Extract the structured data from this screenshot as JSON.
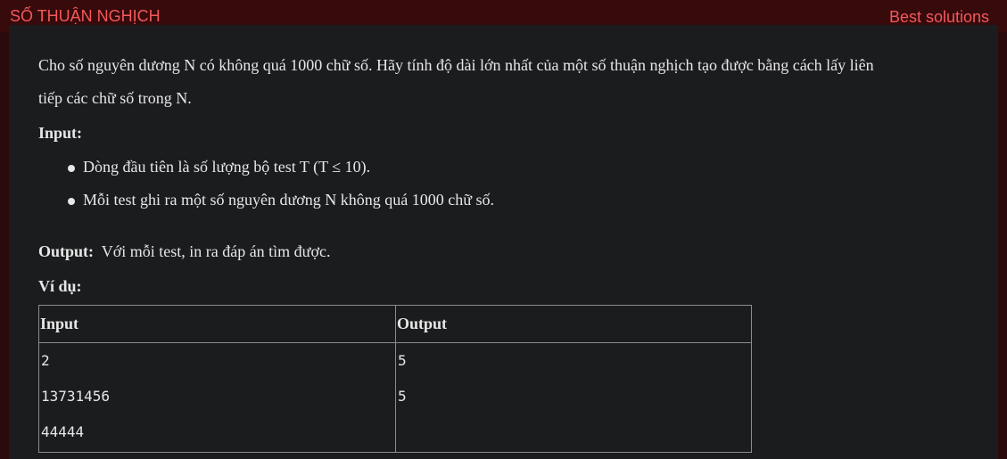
{
  "header": {
    "title": "SỐ THUẬN NGHỊCH",
    "best_solutions": "Best solutions"
  },
  "problem": {
    "statement_line1": "Cho số nguyên dương N có không quá 1000 chữ số. Hãy tính độ dài lớn nhất của một số thuận nghịch tạo được bằng cách lấy liên",
    "statement_line2": "tiếp các chữ số trong N.",
    "input_label": "Input:",
    "input_items": [
      "Dòng đầu tiên là số lượng bộ test T (T ≤ 10).",
      "Mỗi test ghi ra một số nguyên dương N không quá 1000 chữ số."
    ],
    "output_label": "Output:",
    "output_text": "Với mỗi test, in ra đáp án tìm được.",
    "example_label": "Ví dụ:"
  },
  "example_table": {
    "headers": [
      "Input",
      "Output"
    ],
    "input_lines": [
      "2",
      "13731456",
      "44444"
    ],
    "output_lines": [
      "5",
      "5"
    ]
  }
}
